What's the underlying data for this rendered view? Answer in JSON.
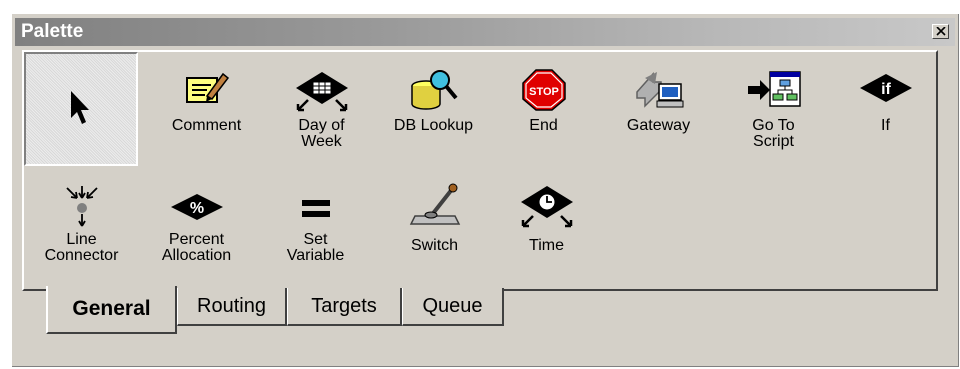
{
  "window": {
    "title": "Palette",
    "close_icon": "close-icon"
  },
  "tools": [
    {
      "id": "pointer",
      "label": "",
      "icon": "arrow-pointer-icon",
      "selected": true
    },
    {
      "id": "comment",
      "label": "Comment",
      "icon": "notepad-pencil-icon"
    },
    {
      "id": "day-of-week",
      "label": "Day of\nWeek",
      "icon": "calendar-diamond-icon"
    },
    {
      "id": "db-lookup",
      "label": "DB Lookup",
      "icon": "database-magnifier-icon"
    },
    {
      "id": "end",
      "label": "End",
      "icon": "stop-sign-icon"
    },
    {
      "id": "gateway",
      "label": "Gateway",
      "icon": "gateway-computer-icon"
    },
    {
      "id": "go-to-script",
      "label": "Go To\nScript",
      "icon": "go-to-script-icon"
    },
    {
      "id": "if",
      "label": "If",
      "icon": "if-diamond-icon"
    },
    {
      "id": "line-connector",
      "label": "Line\nConnector",
      "icon": "line-connector-icon"
    },
    {
      "id": "percent-allocation",
      "label": "Percent\nAllocation",
      "icon": "percent-diamond-icon"
    },
    {
      "id": "set-variable",
      "label": "Set\nVariable",
      "icon": "equals-icon"
    },
    {
      "id": "switch",
      "label": "Switch",
      "icon": "switch-lever-icon"
    },
    {
      "id": "time",
      "label": "Time",
      "icon": "clock-diamond-icon"
    }
  ],
  "tabs": [
    {
      "label": "General",
      "active": true
    },
    {
      "label": "Routing"
    },
    {
      "label": "Targets"
    },
    {
      "label": "Queue"
    }
  ]
}
